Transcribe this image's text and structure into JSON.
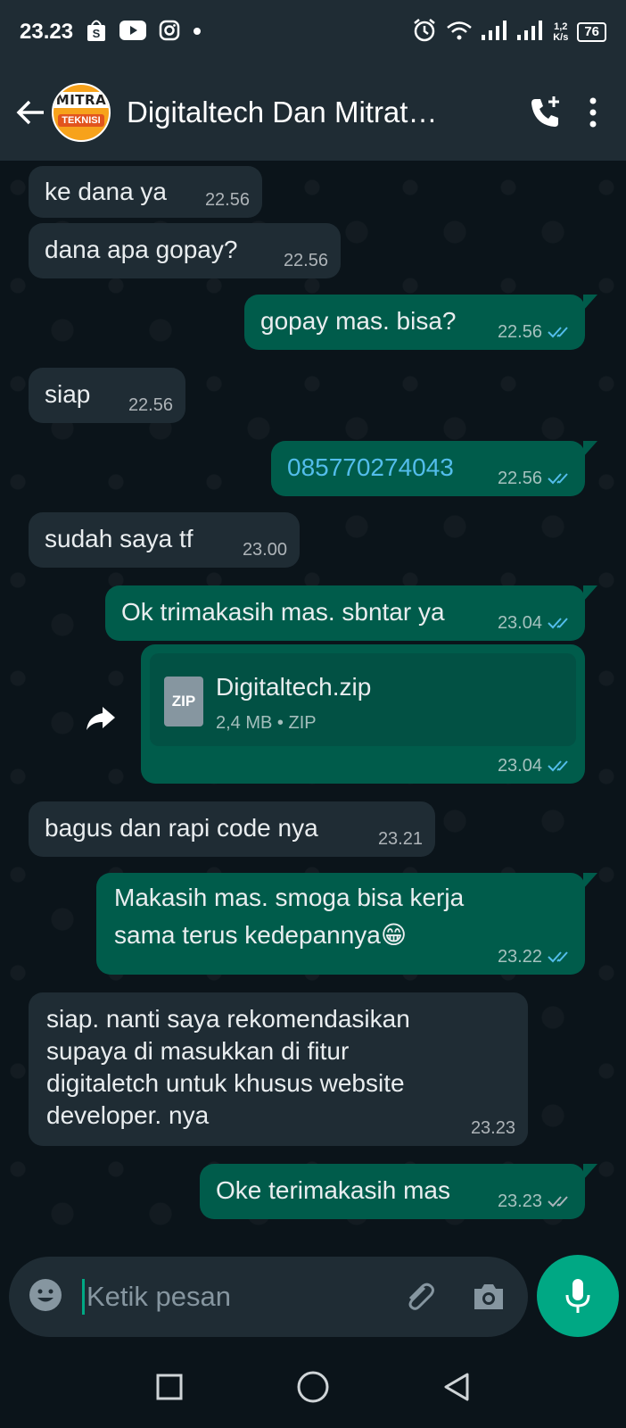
{
  "status_bar": {
    "time": "23.23",
    "net_speed_value": "1,2",
    "net_speed_unit": "K/s",
    "battery": "76",
    "icons": [
      "shopee-icon",
      "youtube-icon",
      "instagram-icon",
      "dot-icon",
      "alarm-icon",
      "wifi-icon",
      "signal-icon",
      "signal-icon",
      "battery-icon"
    ]
  },
  "header": {
    "contact_name": "Digitaltech Dan Mitrat…",
    "avatar_top": "MITRA",
    "avatar_bottom": "TEKNISI"
  },
  "messages": [
    {
      "dir": "in",
      "text": "ke dana ya",
      "time": "22.56"
    },
    {
      "dir": "in",
      "text": "dana apa gopay?",
      "time": "22.56"
    },
    {
      "dir": "out",
      "text": "gopay mas. bisa?",
      "time": "22.56",
      "status": "read"
    },
    {
      "dir": "in",
      "text": "siap",
      "time": "22.56"
    },
    {
      "dir": "out",
      "text": "085770274043",
      "time": "22.56",
      "status": "read"
    },
    {
      "dir": "in",
      "text": "sudah saya tf",
      "time": "23.00"
    },
    {
      "dir": "out",
      "text": "Ok trimakasih mas. sbntar ya",
      "time": "23.04",
      "status": "read"
    },
    {
      "dir": "out",
      "type": "file",
      "file_name": "Digitaltech.zip",
      "file_icon": "ZIP",
      "file_info": "2,4 MB • ZIP",
      "time": "23.04",
      "status": "read"
    },
    {
      "dir": "in",
      "text": "bagus dan rapi code nya",
      "time": "23.21"
    },
    {
      "dir": "out",
      "text_line1": "Makasih mas. smoga bisa kerja",
      "text_line2": "sama terus kedepannya",
      "emoji": "😁",
      "time": "23.22",
      "status": "read"
    },
    {
      "dir": "in",
      "lines": [
        "siap. nanti saya rekomendasikan",
        "supaya di masukkan di fitur",
        "digitaletch untuk khusus website",
        "developer. nya"
      ],
      "time": "23.23"
    },
    {
      "dir": "out",
      "text": "Oke terimakasih mas",
      "time": "23.23",
      "status": "delivered"
    }
  ],
  "composer": {
    "placeholder": "Ketik pesan"
  },
  "colors": {
    "accent": "#00a884",
    "incoming_bubble": "#1f2c34",
    "outgoing_bubble": "#005c4b",
    "read_tick": "#53bdeb",
    "link": "#53bdeb"
  }
}
